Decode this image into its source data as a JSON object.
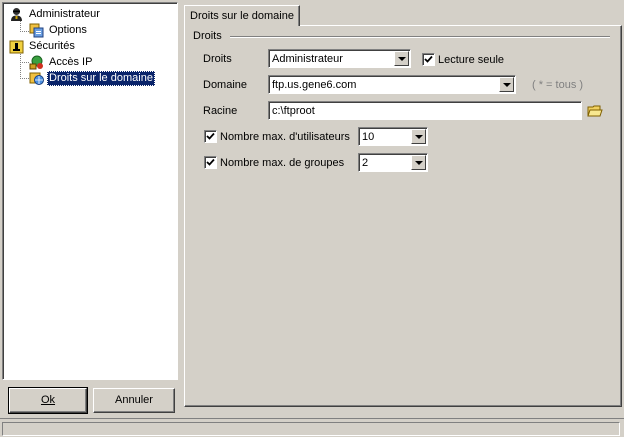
{
  "tree": {
    "items": [
      {
        "label": "Administrateur",
        "icon": "admin-user-icon"
      },
      {
        "label": "Options",
        "icon": "options-icon"
      },
      {
        "label": "Sécurités",
        "icon": "security-lock-icon"
      },
      {
        "label": "Accès IP",
        "icon": "ip-access-icon"
      },
      {
        "label": "Droits sur le domaine",
        "icon": "domain-rights-icon"
      }
    ],
    "selected": "Droits sur le domaine"
  },
  "buttons": {
    "ok": "Ok",
    "cancel": "Annuler"
  },
  "tab": {
    "label": "Droits sur le domaine"
  },
  "group": {
    "title": "Droits"
  },
  "form": {
    "droits_label": "Droits",
    "droits_value": "Administrateur",
    "readonly_label": "Lecture seule",
    "readonly_checked": true,
    "domaine_label": "Domaine",
    "domaine_value": "ftp.us.gene6.com",
    "domaine_hint": "( * = tous )",
    "racine_label": "Racine",
    "racine_value": "c:\\ftproot",
    "max_users_label": "Nombre max. d'utilisateurs",
    "max_users_checked": true,
    "max_users_value": "10",
    "max_groups_label": "Nombre max. de groupes",
    "max_groups_checked": true,
    "max_groups_value": "2"
  },
  "colors": {
    "face": "#d4d0c8",
    "selection": "#0a246a",
    "hint": "#808080"
  }
}
